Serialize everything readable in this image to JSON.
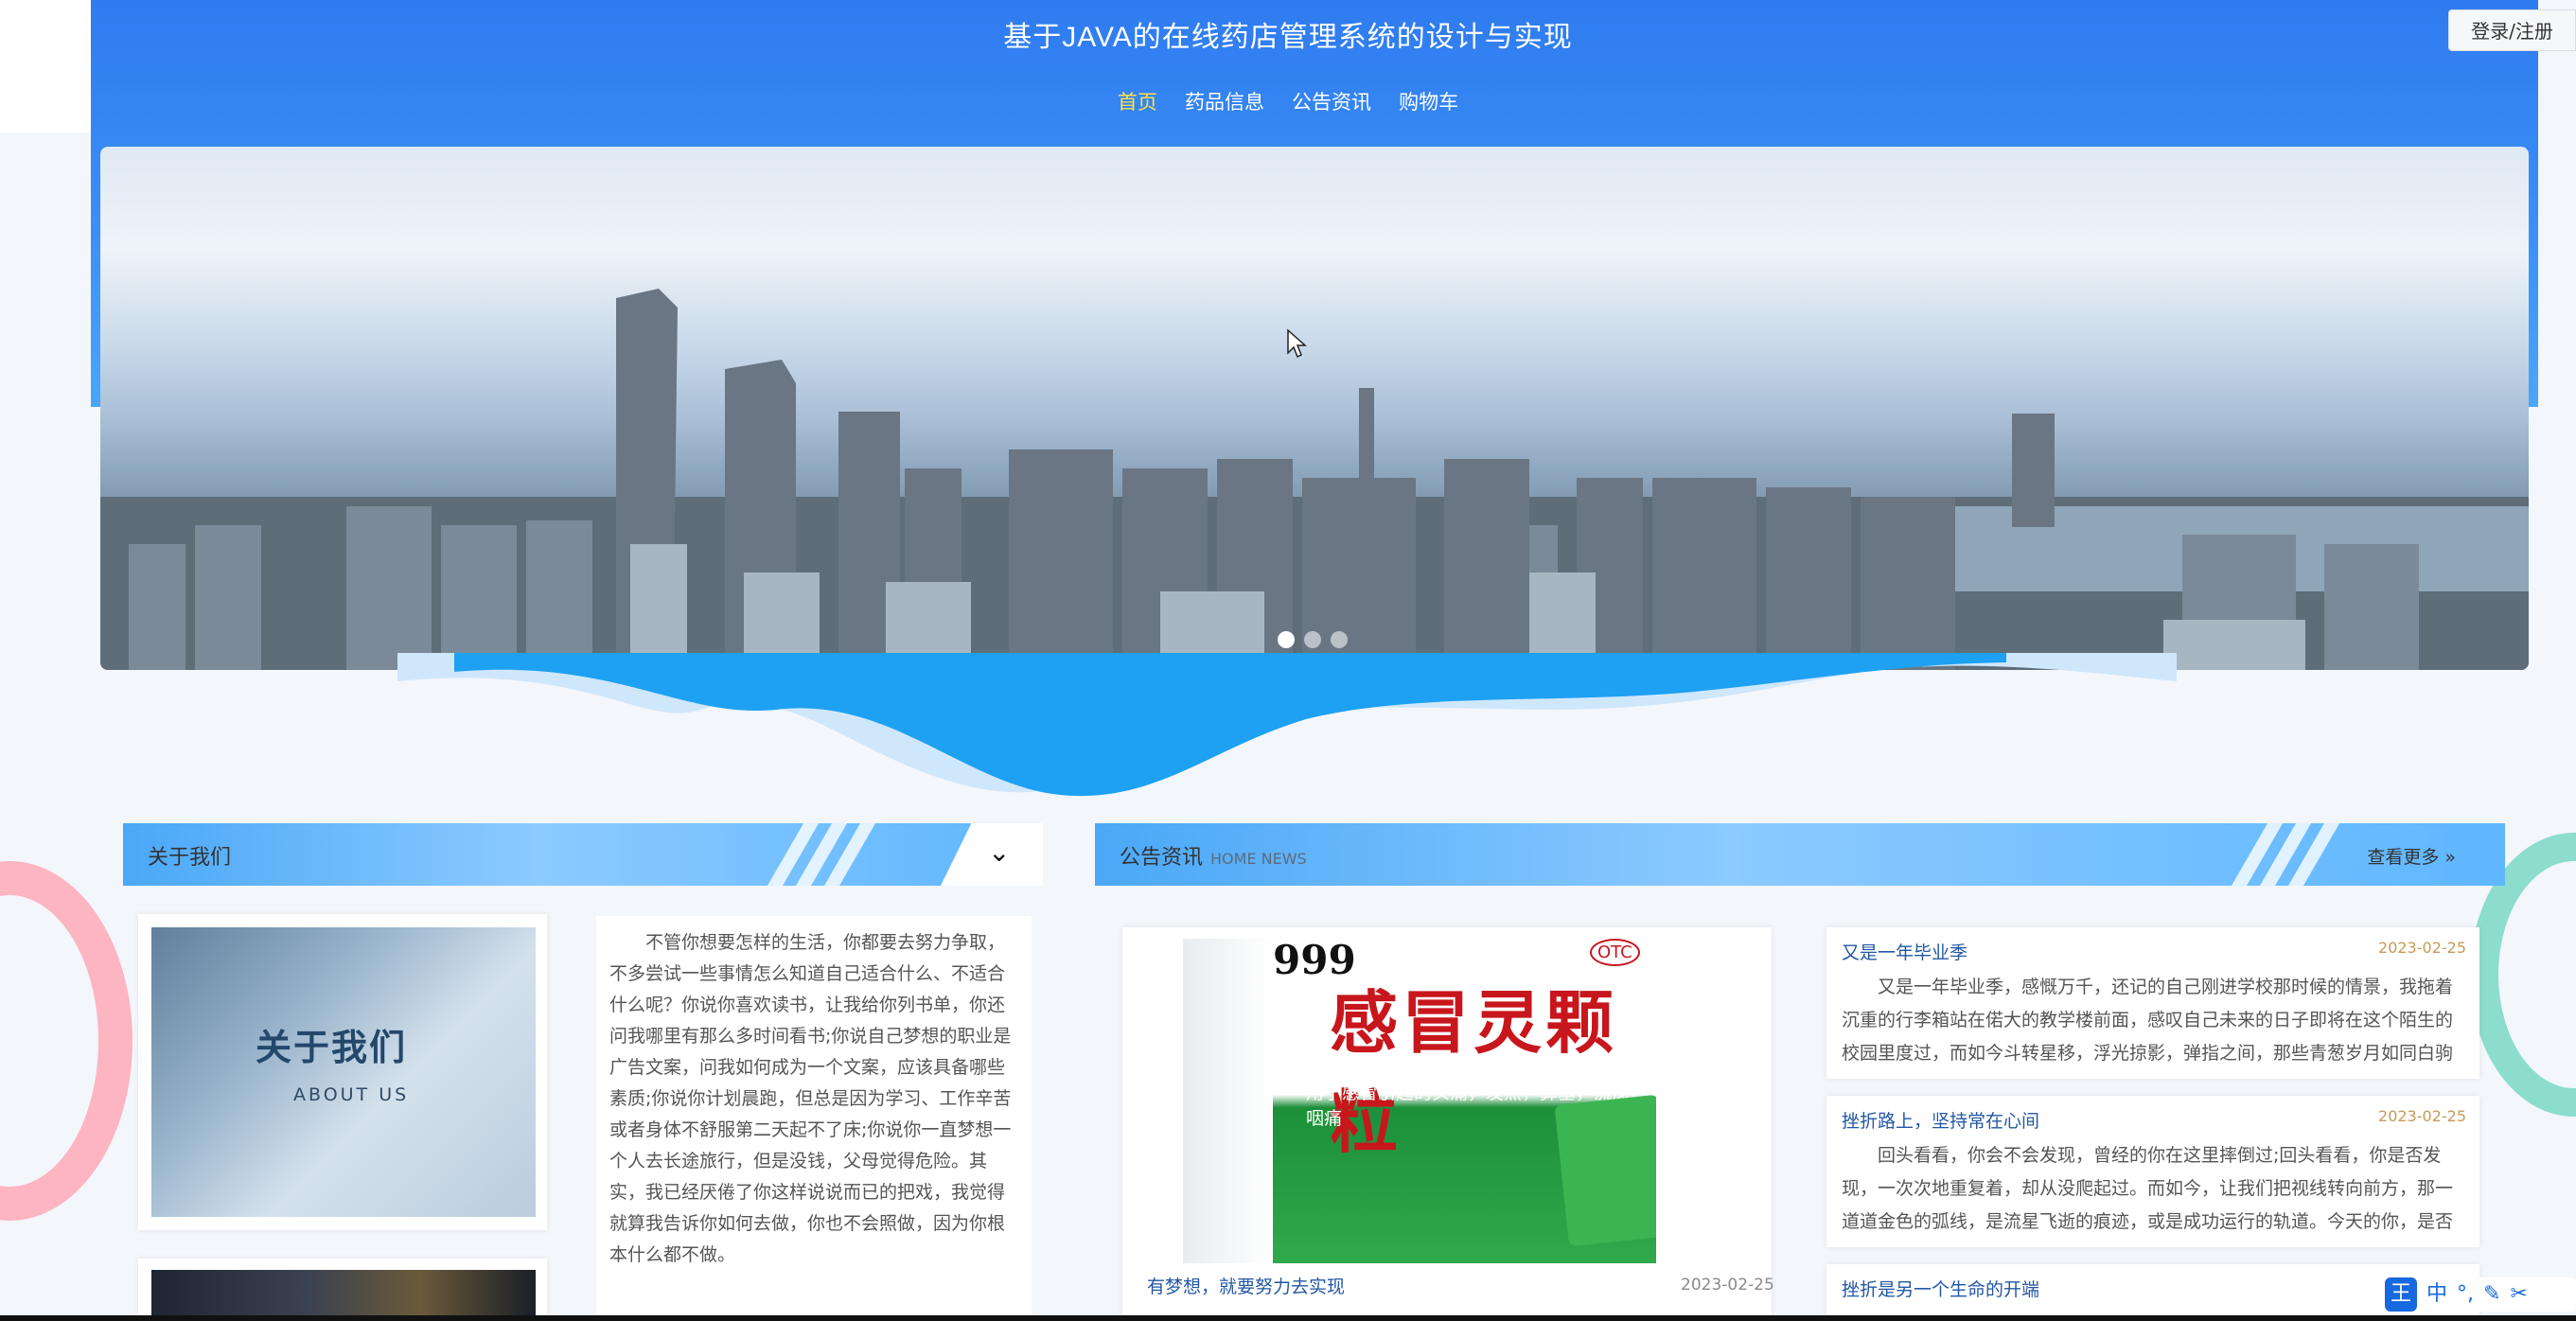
{
  "header": {
    "site_title": "基于JAVA的在线药店管理系统的设计与实现",
    "login_label": "登录/注册"
  },
  "nav": {
    "items": [
      {
        "label": "首页",
        "active": true
      },
      {
        "label": "药品信息",
        "active": false
      },
      {
        "label": "公告资讯",
        "active": false
      },
      {
        "label": "购物车",
        "active": false
      }
    ]
  },
  "banner": {
    "slide_count": 3,
    "active_slide": 1
  },
  "about": {
    "section_title": "关于我们",
    "image_title": "关于我们",
    "image_subtitle": "ABOUT US",
    "toggle_icon": "chevron-down-icon",
    "text": "不管你想要怎样的生活，你都要去努力争取，不多尝试一些事情怎么知道自己适合什么、不适合什么呢？你说你喜欢读书，让我给你列书单，你还问我哪里有那么多时间看书;你说自己梦想的职业是广告文案，问我如何成为一个文案，应该具备哪些素质;你说你计划晨跑，但总是因为学习、工作辛苦或者身体不舒服第二天起不了床;你说你一直梦想一个人去长途旅行，但是没钱，父母觉得危险。其实，我已经厌倦了你这样说说而已的把戏，我觉得就算我告诉你如何去做，你也不会照做，因为你根本什么都不做。"
  },
  "news": {
    "section_title": "公告资讯",
    "section_subtitle": "HOME NEWS",
    "more_label": "查看更多 »",
    "featured": {
      "title": "有梦想，就要努力去实现",
      "date": "2023-02-25",
      "image": {
        "brand": "999",
        "product": "感冒灵颗粒",
        "otc": "OTC",
        "desc": "用于感冒引起的头痛，发热，鼻塞，流涕，咽痛"
      }
    },
    "items": [
      {
        "title": "又是一年毕业季",
        "date": "2023-02-25",
        "excerpt": "又是一年毕业季，感慨万千，还记的自己刚进学校那时候的情景，我拖着沉重的行李箱站在偌大的教学楼前面，感叹自己未来的日子即将在这个陌生的校园里度过，而如今斗转星移，浮光掠影，弹指之间，那些青葱岁月如同白驹"
      },
      {
        "title": "挫折路上，坚持常在心间",
        "date": "2023-02-25",
        "excerpt": "回头看看，你会不会发现，曾经的你在这里摔倒过;回头看看，你是否发现，一次次地重复着，却从没爬起过。而如今，让我们把视线转向前方，那一道道金色的弧线，是流星飞逝的痕迹，或是成功运行的轨道。今天的你，是否"
      },
      {
        "title": "挫折是另一个生命的开端",
        "date": "",
        "excerpt": ""
      }
    ]
  },
  "ime": {
    "labels": [
      "王",
      "中",
      "°,",
      "✎",
      "✂"
    ]
  }
}
